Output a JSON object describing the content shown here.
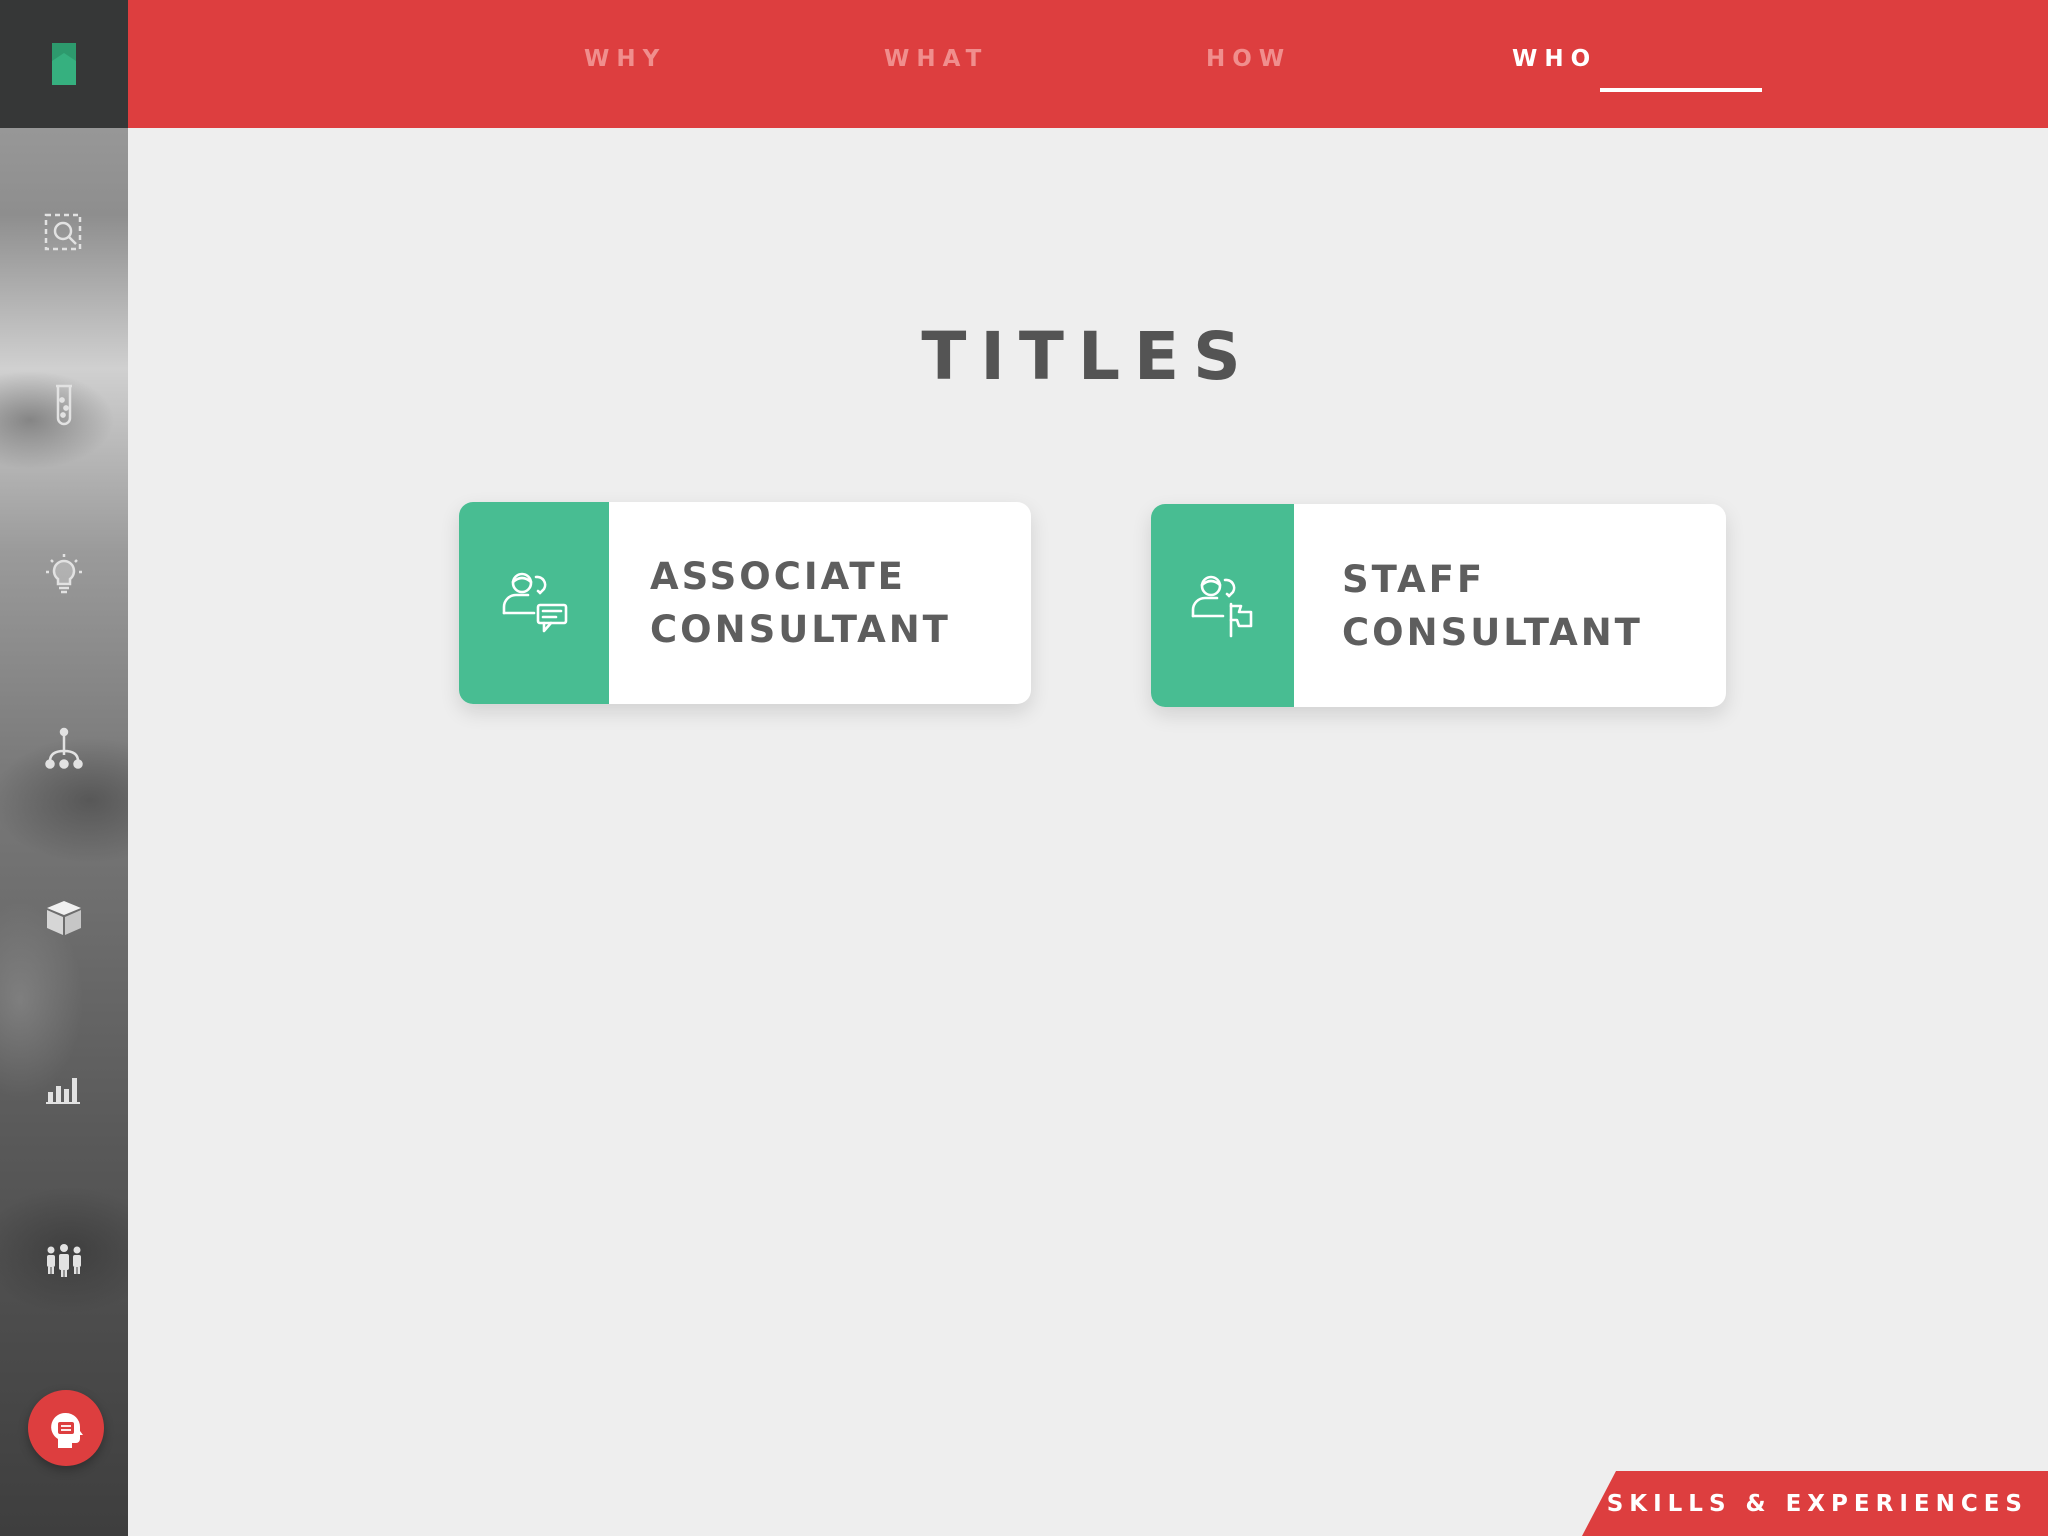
{
  "nav": {
    "tabs": [
      {
        "label": "WHY"
      },
      {
        "label": "WHAT"
      },
      {
        "label": "HOW"
      },
      {
        "label": "WHO"
      }
    ],
    "active_tab": "WHO"
  },
  "sidebar": {
    "icons": [
      "search-selection-icon",
      "test-tube-icon",
      "lightbulb-icon",
      "hierarchy-icon",
      "cube-icon",
      "bar-chart-icon",
      "team-icon",
      "help-chat-icon"
    ]
  },
  "main": {
    "title": "TITLES",
    "cards": [
      {
        "line1": "ASSOCIATE",
        "line2": "CONSULTANT",
        "icon": "consultant-chat-icon"
      },
      {
        "line1": "STAFF",
        "line2": "CONSULTANT",
        "icon": "consultant-flag-icon"
      }
    ]
  },
  "footer": {
    "section_label": "SKILLS & EXPERIENCES"
  },
  "colors": {
    "header_red": "#dd3e3f",
    "accent_green": "#48bd92",
    "background": "#eeeeee",
    "title_gray": "#545454"
  }
}
